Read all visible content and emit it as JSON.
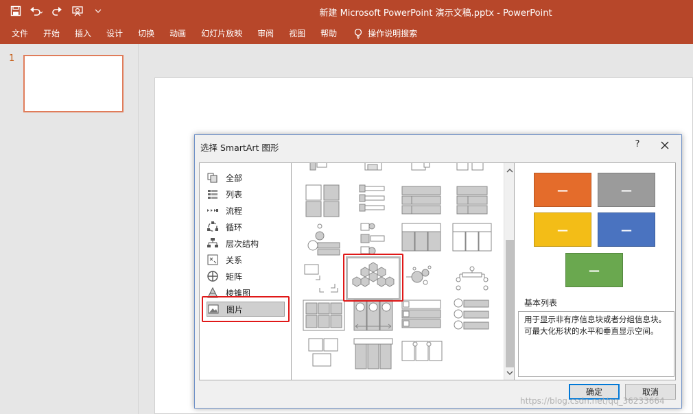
{
  "window": {
    "title": "新建 Microsoft PowerPoint 演示文稿.pptx  -  PowerPoint"
  },
  "qat": {
    "icons": [
      "save-icon",
      "undo-icon",
      "redo-icon",
      "presenter-icon",
      "customize-icon"
    ]
  },
  "ribbon": {
    "tabs": [
      "文件",
      "开始",
      "插入",
      "设计",
      "切换",
      "动画",
      "幻灯片放映",
      "审阅",
      "视图",
      "帮助"
    ],
    "tell_me": "操作说明搜索"
  },
  "slides": {
    "thumbnail_number": "1"
  },
  "dialog": {
    "title": "选择 SmartArt 图形",
    "help": "?",
    "categories": [
      "全部",
      "列表",
      "流程",
      "循环",
      "层次结构",
      "关系",
      "矩阵",
      "棱锥图",
      "图片"
    ],
    "selected_category": "图片",
    "preview": {
      "name": "基本列表",
      "description": "用于显示非有序信息块或者分组信息块。可最大化形状的水平和垂直显示空间。",
      "box_label": "—",
      "colors": [
        "#e46c2b",
        "#9b9b9b",
        "#f3bd17",
        "#4a73c0",
        "#6aa84f"
      ]
    },
    "ok_label": "确定",
    "cancel_label": "取消"
  },
  "watermark": "https://blog.csdn.net/qq_36233664"
}
